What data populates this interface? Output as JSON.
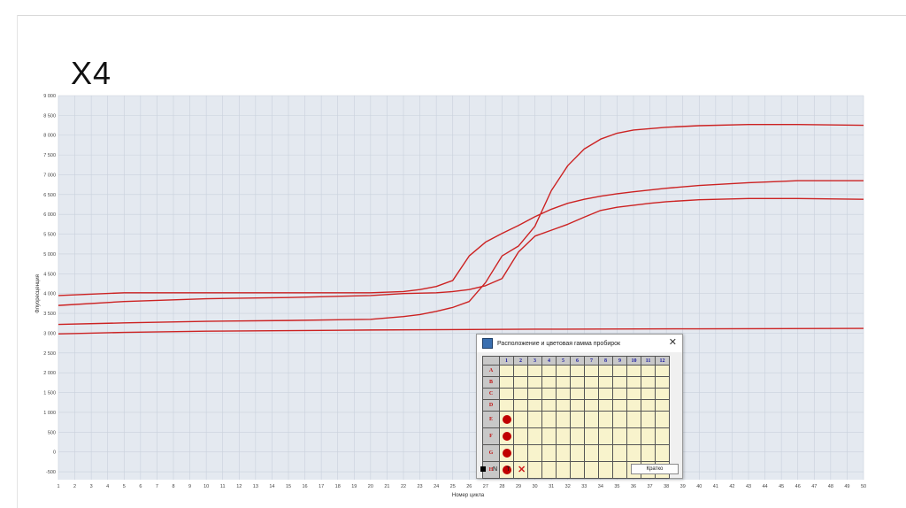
{
  "slide": {
    "title": "X4"
  },
  "chart_data": {
    "type": "line",
    "title": "",
    "xlabel": "Номер цикла",
    "ylabel": "Флуоресценция",
    "xlim": [
      1,
      50
    ],
    "ylim": [
      -700,
      9000
    ],
    "x_ticks": [
      1,
      2,
      3,
      4,
      5,
      6,
      7,
      8,
      9,
      10,
      11,
      12,
      13,
      14,
      15,
      16,
      17,
      18,
      19,
      20,
      21,
      22,
      23,
      24,
      25,
      26,
      27,
      28,
      29,
      30,
      31,
      32,
      33,
      34,
      35,
      36,
      37,
      38,
      39,
      40,
      41,
      42,
      43,
      44,
      45,
      46,
      47,
      48,
      49,
      50
    ],
    "y_ticks": [
      -500,
      0,
      500,
      1000,
      1500,
      2000,
      2500,
      3000,
      3500,
      4000,
      4500,
      5000,
      5500,
      6000,
      6500,
      7000,
      7500,
      8000,
      8500,
      9000
    ],
    "y_tick_labels": [
      "-500",
      "0",
      "500",
      "1 000",
      "1 500",
      "2 000",
      "2 500",
      "3 000",
      "3 500",
      "4 000",
      "4 500",
      "5 000",
      "5 500",
      "6 000",
      "6 500",
      "7 000",
      "7 500",
      "8 000",
      "8 500",
      "9 000"
    ],
    "grid": true,
    "line_color": "#cc2222",
    "background": "#e4e9f0",
    "series": [
      {
        "x": [
          1,
          5,
          10,
          15,
          20,
          22,
          23,
          24,
          25,
          26,
          27,
          28,
          29,
          30,
          31,
          32,
          33,
          34,
          35,
          36,
          38,
          40,
          43,
          46,
          50
        ],
        "values": [
          3950,
          4020,
          4020,
          4020,
          4020,
          4050,
          4100,
          4180,
          4330,
          4950,
          5300,
          5520,
          5720,
          5940,
          6130,
          6280,
          6380,
          6460,
          6520,
          6570,
          6660,
          6730,
          6800,
          6850,
          6850
        ]
      },
      {
        "x": [
          1,
          5,
          10,
          15,
          20,
          22,
          24,
          25,
          26,
          27,
          28,
          29,
          30,
          31,
          32,
          33,
          34,
          35,
          36,
          37,
          38,
          40,
          43,
          46,
          50
        ],
        "values": [
          3700,
          3800,
          3870,
          3900,
          3950,
          4000,
          4020,
          4050,
          4100,
          4200,
          4380,
          5050,
          5450,
          5600,
          5750,
          5930,
          6100,
          6180,
          6230,
          6280,
          6320,
          6370,
          6400,
          6400,
          6380
        ]
      },
      {
        "x": [
          1,
          5,
          10,
          15,
          20,
          22,
          23,
          24,
          25,
          26,
          27,
          28,
          29,
          30,
          31,
          32,
          33,
          34,
          35,
          36,
          38,
          40,
          43,
          46,
          50
        ],
        "values": [
          3220,
          3260,
          3300,
          3320,
          3350,
          3420,
          3470,
          3550,
          3650,
          3800,
          4280,
          4950,
          5200,
          5700,
          6600,
          7230,
          7650,
          7900,
          8050,
          8130,
          8200,
          8240,
          8270,
          8270,
          8250
        ]
      },
      {
        "x": [
          1,
          5,
          10,
          20,
          30,
          40,
          50
        ],
        "values": [
          2980,
          3020,
          3050,
          3080,
          3100,
          3110,
          3120
        ]
      }
    ]
  },
  "dialog": {
    "title": "Расположение и цветовая гамма пробирок",
    "columns": [
      "1",
      "2",
      "3",
      "4",
      "5",
      "6",
      "7",
      "8",
      "9",
      "10",
      "11",
      "12"
    ],
    "rows": [
      "A",
      "B",
      "C",
      "D",
      "E",
      "F",
      "G",
      "H"
    ],
    "filled_wells": [
      "E1",
      "F1",
      "G1",
      "H1"
    ],
    "well_color": "#c00000",
    "footer": {
      "n_label": "N",
      "t_label": "T",
      "brief_button": "Кратко"
    }
  }
}
